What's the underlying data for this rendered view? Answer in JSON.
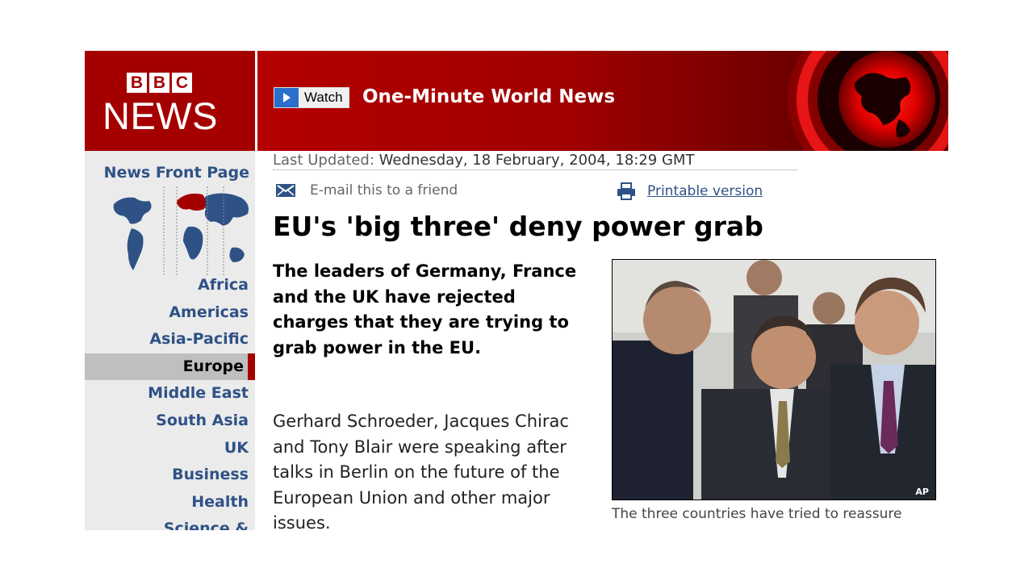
{
  "header": {
    "bbc_letters": [
      "B",
      "B",
      "C"
    ],
    "news_word": "NEWS",
    "watch_label": "Watch",
    "banner_title": "One-Minute World News"
  },
  "sidebar": {
    "front_page": "News Front Page",
    "nav": [
      {
        "label": "Africa",
        "active": false
      },
      {
        "label": "Americas",
        "active": false
      },
      {
        "label": "Asia-Pacific",
        "active": false
      },
      {
        "label": "Europe",
        "active": true
      },
      {
        "label": "Middle East",
        "active": false
      },
      {
        "label": "South Asia",
        "active": false
      },
      {
        "label": "UK",
        "active": false
      },
      {
        "label": "Business",
        "active": false
      },
      {
        "label": "Health",
        "active": false
      },
      {
        "label": "Science &",
        "active": false
      }
    ]
  },
  "article": {
    "last_updated_label": "Last Updated:",
    "last_updated_value": "Wednesday, 18 February, 2004, 18:29 GMT",
    "email_link": "E-mail this to a friend",
    "print_link": "Printable version",
    "headline": "EU's 'big three' deny power grab",
    "intro": "The leaders of Germany, France and the UK have rejected charges that they are trying to grab power in the EU.",
    "body": "Gerhard Schroeder, Jacques Chirac and Tony Blair were speaking after talks in Berlin on the future of the European Union and other major issues.",
    "photo_credit": "AP",
    "caption": "The three countries have tried to reassure other EU members"
  },
  "colors": {
    "brand_red": "#a50000",
    "link_blue": "#2f5286",
    "active_nav_bg": "#bfbfbf"
  },
  "icons": {
    "email": "envelope-icon",
    "print": "printer-icon",
    "play": "play-icon"
  }
}
